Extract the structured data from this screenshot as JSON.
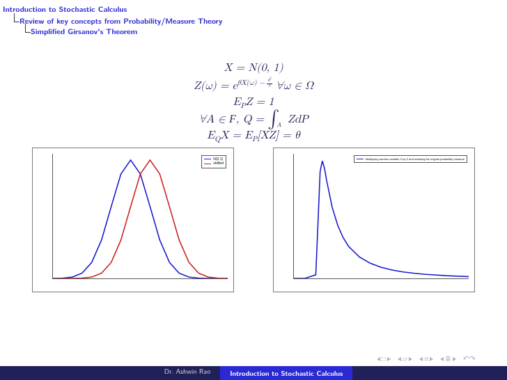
{
  "outline": {
    "lvl0": "Introduction to Stochastic Calculus",
    "lvl1": "Review of key concepts from Probability/Measure Theory",
    "lvl2": "Simplified Girsanov's Theorem"
  },
  "equations": {
    "e1": "X = N(0, 1)",
    "e2_left": "Z(ω) = e",
    "e2_exp_a": "θX(ω) − ",
    "e2_exp_theta": "θ",
    "e2_exp_two": "2",
    "e2_right": " ∀ω ∈ Ω",
    "e3_left": "E",
    "e3_sub": "P",
    "e3_right": "Z = 1",
    "e4_left": "∀A ∈ ",
    "e4_F": "F",
    "e4_mid": ", Q = ",
    "e4_int": "∫",
    "e4_A": "A",
    "e4_right": " ZdP",
    "e5_a": "E",
    "e5_Q": "Q",
    "e5_b": "X = E",
    "e5_P": "P",
    "e5_c": "[XZ] = θ"
  },
  "legend_left": {
    "item1": "N(0,1)",
    "item2": "shifted"
  },
  "legend_right": {
    "item1": "Multiplying random variable X by Z and retaining the original probability measure"
  },
  "footer": {
    "author": "Dr. Ashwin Rao",
    "title": "Introduction to Stochastic Calculus"
  },
  "nav": {
    "first": "□",
    "frame": "▱",
    "sect": "≡",
    "subsect": "≣"
  },
  "chart_data": [
    {
      "type": "line",
      "title": "",
      "xlabel": "",
      "ylabel": "",
      "xlim": [
        -4,
        5
      ],
      "ylim": [
        0,
        0.42
      ],
      "x": [
        -4,
        -3.5,
        -3,
        -2.5,
        -2,
        -1.5,
        -1,
        -0.5,
        0,
        0.5,
        1,
        1.5,
        2,
        2.5,
        3,
        3.5,
        4,
        4.5,
        5
      ],
      "series": [
        {
          "name": "N(0,1)",
          "color": "#1818cc",
          "values": [
            0.0001,
            0.0009,
            0.0044,
            0.0175,
            0.054,
            0.1295,
            0.242,
            0.3521,
            0.3989,
            0.3521,
            0.242,
            0.1295,
            0.054,
            0.0175,
            0.0044,
            0.0009,
            0.0001,
            2e-05,
            3e-06
          ]
        },
        {
          "name": "shifted",
          "color": "#cc2020",
          "values": [
            3e-06,
            2e-05,
            0.0001,
            0.0009,
            0.0044,
            0.0175,
            0.054,
            0.1295,
            0.242,
            0.3521,
            0.3989,
            0.3521,
            0.242,
            0.1295,
            0.054,
            0.0175,
            0.0044,
            0.0009,
            0.0001
          ]
        }
      ]
    },
    {
      "type": "line",
      "title": "",
      "xlabel": "",
      "ylabel": "",
      "xlim": [
        -2,
        14
      ],
      "ylim": [
        0,
        0.7
      ],
      "x": [
        -2,
        -1,
        0,
        0.2,
        0.4,
        0.6,
        0.8,
        1,
        1.5,
        2,
        2.5,
        3,
        4,
        5,
        6,
        7,
        8,
        9,
        10,
        12,
        14
      ],
      "series": [
        {
          "name": "Multiplying random variable X by Z and retaining the original probability measure",
          "color": "#1818cc",
          "values": [
            0,
            0,
            0.02,
            0.3,
            0.6,
            0.66,
            0.62,
            0.55,
            0.4,
            0.3,
            0.23,
            0.18,
            0.12,
            0.085,
            0.062,
            0.047,
            0.036,
            0.029,
            0.023,
            0.015,
            0.01
          ]
        }
      ]
    }
  ]
}
